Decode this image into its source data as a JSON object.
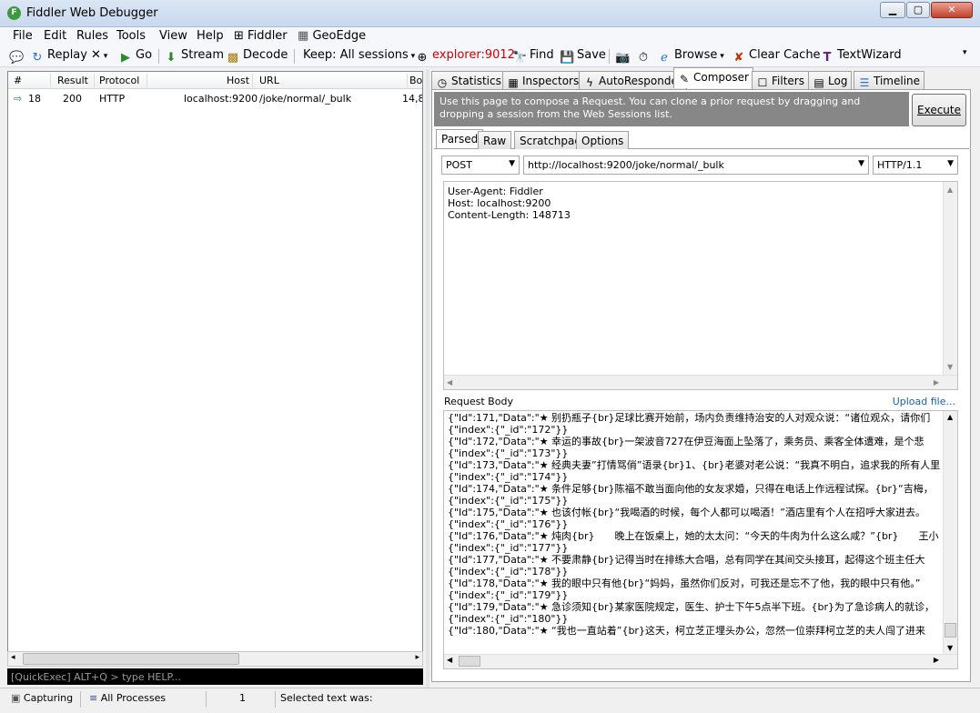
{
  "window": {
    "title": "Fiddler Web Debugger",
    "controls": [
      "0",
      "1",
      "r"
    ]
  },
  "menu": {
    "items": [
      "File",
      "Edit",
      "Rules",
      "Tools",
      "View",
      "Help",
      "Fiddler",
      "GeoEdge"
    ]
  },
  "toolbar": {
    "replay": "Replay",
    "remove": "✕",
    "go": "Go",
    "stream": "Stream",
    "decode": "Decode",
    "keep": "Keep: All sessions",
    "process": "explorer:9012",
    "find": "Find",
    "save": "Save",
    "browse": "Browse",
    "clear_cache": "Clear Cache",
    "text_wizard": "TextWizard",
    "accent_color": "#d20000"
  },
  "sessions": {
    "columns": [
      "#",
      "Result",
      "Protocol",
      "Host",
      "URL",
      "Bod"
    ],
    "rows": [
      {
        "id": "18",
        "result": "200",
        "protocol": "HTTP",
        "host": "localhost:9200",
        "url": "/joke/normal/_bulk",
        "body": "14,8"
      }
    ],
    "quickexec_placeholder": "[QuickExec] ALT+Q > type HELP..."
  },
  "inspector_tabs": [
    {
      "label": "Statistics",
      "icon": "stopwatch-icon"
    },
    {
      "label": "Inspectors",
      "icon": "inspector-icon"
    },
    {
      "label": "AutoResponder",
      "icon": "lightning-icon"
    },
    {
      "label": "Composer",
      "icon": "pencil-icon"
    },
    {
      "label": "Filters",
      "icon": "checkbox-icon"
    },
    {
      "label": "Log",
      "icon": "log-icon"
    },
    {
      "label": "Timeline",
      "icon": "timeline-icon"
    }
  ],
  "composer": {
    "info": "Use this page to compose a Request. You can clone a prior request by dragging and dropping a session from the Web Sessions list.",
    "execute": "Execute",
    "subtabs": [
      "Parsed",
      "Raw",
      "Scratchpad",
      "Options"
    ],
    "method": "POST",
    "url": "http://localhost:9200/joke/normal/_bulk",
    "version": "HTTP/1.1",
    "headers": [
      "User-Agent: Fiddler",
      "Host: localhost:9200",
      "Content-Length: 148713"
    ],
    "request_body_label": "Request Body",
    "upload_label": "Upload file...",
    "body_lines": [
      "{\"Id\":171,\"Data\":\"★ 别扔瓶子{br}足球比赛开始前，场内负责维持治安的人对观众说：“诸位观众，请你们",
      "{\"index\":{\"_id\":\"172\"}}",
      "{\"Id\":172,\"Data\":\"★ 幸运的事故{br}一架波音727在伊豆海面上坠落了，乘务员、乘客全体遭难，是个悲",
      "{\"index\":{\"_id\":\"173\"}}",
      "{\"Id\":173,\"Data\":\"★ 经典夫妻”打情骂俏”语录{br}1、{br}老婆对老公说：“我真不明白，追求我的所有人里",
      "{\"index\":{\"_id\":\"174\"}}",
      "{\"Id\":174,\"Data\":\"★ 条件足够{br}陈福不敢当面向他的女友求婚，只得在电话上作远程试探。{br}“吉梅，",
      "{\"index\":{\"_id\":\"175\"}}",
      "{\"Id\":175,\"Data\":\"★ 也该付帐{br}“我喝酒的时候，每个人都可以喝酒！”酒店里有个人在招呼大家进去。",
      "{\"index\":{\"_id\":\"176\"}}",
      "{\"Id\":176,\"Data\":\"★ 炖肉{br}　　晚上在饭桌上，她的太太问：“今天的牛肉为什么这么咸？”{br}　　王小",
      "{\"index\":{\"_id\":\"177\"}}",
      "{\"Id\":177,\"Data\":\"★ 不要肃静{br}记得当时在排练大合唱，总有同学在其间交头接耳，起得这个班主任大",
      "{\"index\":{\"_id\":\"178\"}}",
      "{\"Id\":178,\"Data\":\"★ 我的眼中只有他{br}“妈妈，虽然你们反对，可我还是忘不了他，我的眼中只有他。”",
      "{\"index\":{\"_id\":\"179\"}}",
      "{\"Id\":179,\"Data\":\"★ 急诊须知{br}某家医院规定，医生、护士下午5点半下班。{br}为了急诊病人的就诊，",
      "{\"index\":{\"_id\":\"180\"}}",
      "{\"Id\":180,\"Data\":\"★ “我也一直站着”{br}这天，柯立芝正埋头办公，忽然一位崇拜柯立芝的夫人闯了进来"
    ]
  },
  "status": {
    "capturing": "Capturing",
    "processes": "All Processes",
    "count": "1",
    "selected": "Selected text was:"
  }
}
